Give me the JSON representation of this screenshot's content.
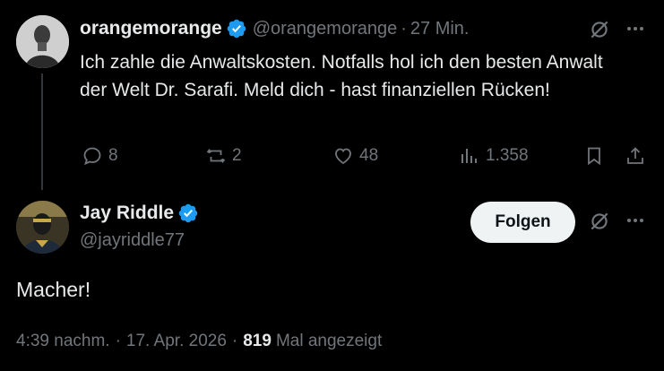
{
  "parent_tweet": {
    "author_name": "orangemorange",
    "author_handle": "@orangemorange",
    "separator": "·",
    "time_ago": "27 Min.",
    "text": "Ich zahle die Anwaltskosten. Notfalls hol ich den besten Anwalt der Welt Dr. Sarafi. Meld dich - hast finanziellen Rücken!",
    "replies": "8",
    "reposts": "2",
    "likes": "48",
    "views": "1.358"
  },
  "reply_tweet": {
    "author_name": "Jay Riddle",
    "author_handle": "@jayriddle77",
    "follow_label": "Folgen",
    "text": "Macher!",
    "time": "4:39 nachm.",
    "sep1": "·",
    "date": "17. Apr. 2026",
    "sep2": "·",
    "views_count": "819",
    "views_label": "Mal angezeigt"
  },
  "colors": {
    "background": "#000000",
    "text_primary": "#e7e9ea",
    "text_secondary": "#71767b",
    "verified_blue": "#1d9bf0",
    "follow_button_bg": "#eff3f4"
  },
  "icons": [
    "verified-badge-icon",
    "grok-icon",
    "more-icon",
    "reply-icon",
    "repost-icon",
    "like-icon",
    "views-icon",
    "bookmark-icon",
    "share-icon"
  ]
}
